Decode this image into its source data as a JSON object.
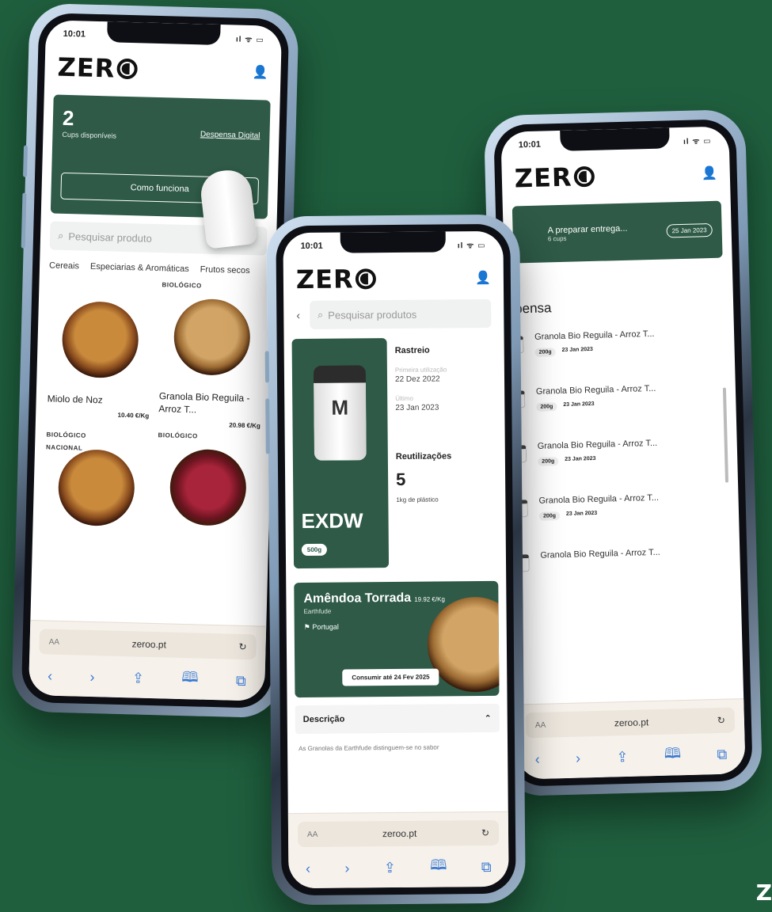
{
  "colors": {
    "background": "#1f5f3e",
    "brand_green": "#2e5a47",
    "safari_bar": "#f6f1ea"
  },
  "status": {
    "time": "10:01",
    "icons": "ıl ᯤ ▭"
  },
  "logo": {
    "text": "ZER",
    "user_icon": "person-icon"
  },
  "safari": {
    "aa": "AA",
    "url": "zeroo.pt",
    "reload": "↻",
    "back": "‹",
    "forward": "›",
    "share": "⇪",
    "bookmarks": "🕮",
    "tabs": "⧉"
  },
  "phone1": {
    "card": {
      "count": "2",
      "count_label": "Cups disponíveis",
      "link": "Despensa Digital",
      "button": "Como funciona"
    },
    "search": {
      "placeholder": "Pesquisar produto"
    },
    "tabs": [
      "Cereais",
      "Especiarias & Aromáticas",
      "Frutos secos"
    ],
    "products": [
      {
        "badge": "",
        "name": "Miolo de Noz",
        "price": "10.40 €/Kg"
      },
      {
        "badge": "BIOLÓGICO",
        "name": "Granola Bio Reguila - Arroz T...",
        "price": "20.98 €/Kg"
      },
      {
        "badge": "BIOLÓGICO NACIONAL",
        "name": "",
        "price": ""
      },
      {
        "badge": "BIOLÓGICO",
        "name": "",
        "price": ""
      }
    ]
  },
  "phone2": {
    "search": {
      "placeholder": "Pesquisar produtos"
    },
    "tile": {
      "jar_letter": "M",
      "code": "EXDW",
      "size": "500g"
    },
    "info": {
      "rastreio": "Rastreio",
      "sub1": "Primeira utilização",
      "date1": "22 Dez 2022",
      "sub2": "Último",
      "date2": "23 Jan 2023",
      "reuse": "Reutilizações",
      "reuse_count": "5",
      "plastic": "1kg de plástico"
    },
    "featured": {
      "name": "Amêndoa Torrada",
      "price": "19.92 €/Kg",
      "brand": "Earthfude",
      "origin": "Portugal",
      "consume": "Consumir até 24 Fev 2025"
    },
    "desc": {
      "title": "Descrição",
      "text": "As Granolas da Earthfude distinguem-se no sabor"
    }
  },
  "phone3": {
    "banner": {
      "title": "A preparar entrega...",
      "cups": "6 cups",
      "date": "25 Jan 2023"
    },
    "section": "espensa",
    "items": [
      {
        "name": "Granola Bio Reguila - Arroz T...",
        "weight": "200g",
        "date": "23 Jan 2023"
      },
      {
        "name": "Granola Bio Reguila - Arroz T...",
        "weight": "200g",
        "date": "23 Jan 2023"
      },
      {
        "name": "Granola Bio Reguila - Arroz T...",
        "weight": "200g",
        "date": "23 Jan 2023"
      },
      {
        "name": "Granola Bio Reguila - Arroz T...",
        "weight": "200g",
        "date": "23 Jan 2023"
      },
      {
        "name": "Granola Bio Reguila - Arroz T...",
        "weight": "",
        "date": ""
      }
    ]
  },
  "corner_mark": "Z"
}
